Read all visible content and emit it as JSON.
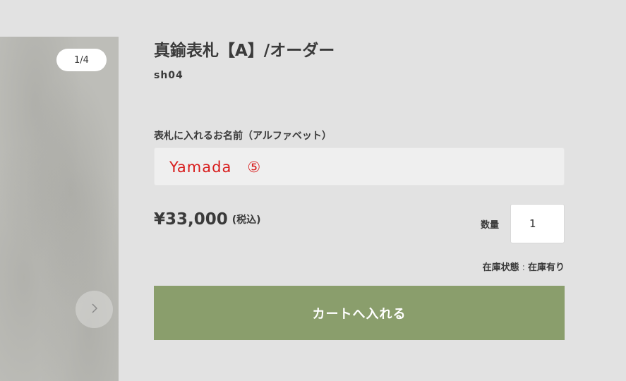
{
  "gallery": {
    "counter": "1/4",
    "next_icon": "chevron-right-icon"
  },
  "product": {
    "title": "真鍮表札【A】/オーダー",
    "sku": "sh04",
    "option_label": "表札に入れるお名前（アルファベット）",
    "name_value": "Yamada　⑤",
    "price": "¥33,000",
    "tax_note": "(税込)",
    "quantity_label": "数量",
    "quantity_value": "1",
    "stock_label": "在庫状態",
    "stock_separator": ":",
    "stock_value": "在庫有り",
    "cart_button": "カートへ入れる"
  },
  "colors": {
    "background": "#e2e2e2",
    "cart_button": "#8a9e6c",
    "name_text": "#d81c1c"
  }
}
